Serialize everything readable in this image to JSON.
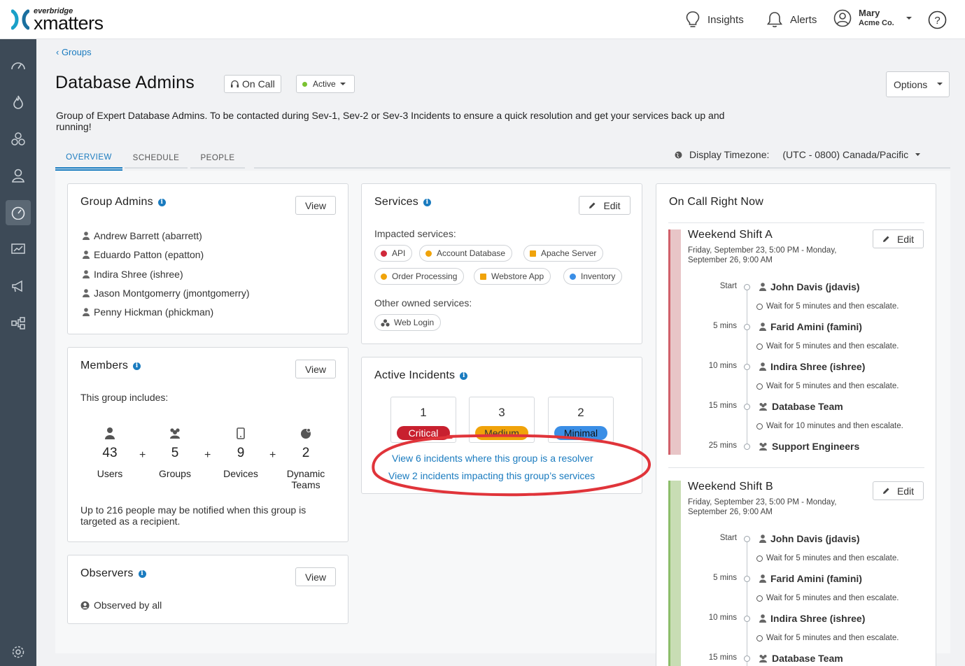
{
  "brand": {
    "small": "everbridge",
    "big": "xmatters"
  },
  "topbar": {
    "insights": "Insights",
    "alerts": "Alerts",
    "user_name": "Mary",
    "user_org": "Acme Co."
  },
  "breadcrumb": "‹ Groups",
  "group": {
    "title": "Database Admins",
    "on_call_label": "On Call",
    "status": "Active",
    "status_color": "#7ac231",
    "description": "Group of Expert Database Admins. To be contacted during Sev-1, Sev-2 or Sev-3 Incidents to ensure a quick resolution and get your services back up and running!"
  },
  "options_label": "Options",
  "tabs": [
    "OVERVIEW",
    "SCHEDULE",
    "PEOPLE"
  ],
  "timezone": {
    "label": "Display Timezone:",
    "value": "(UTC - 0800) Canada/Pacific"
  },
  "admins": {
    "title": "Group Admins",
    "view": "View",
    "people": [
      "Andrew Barrett (abarrett)",
      "Eduardo Patton (epatton)",
      "Indira Shree (ishree)",
      "Jason Montgomerry (jmontgomerry)",
      "Penny Hickman (phickman)"
    ]
  },
  "members": {
    "title": "Members",
    "view": "View",
    "intro": "This group includes:",
    "stats": [
      {
        "num": "43",
        "label": "Users",
        "icon": "user-icon"
      },
      {
        "num": "5",
        "label": "Groups",
        "icon": "group-icon"
      },
      {
        "num": "9",
        "label": "Devices",
        "icon": "device-icon"
      },
      {
        "num": "2",
        "label": "Dynamic Teams",
        "icon": "dynamic-team-icon"
      }
    ],
    "plus": "+",
    "note": "Up to 216 people may be notified when this group is targeted as a recipient."
  },
  "observers": {
    "title": "Observers",
    "view": "View",
    "text": "Observed by all"
  },
  "services": {
    "title": "Services",
    "edit": "Edit",
    "impacted_label": "Impacted services:",
    "impacted": [
      {
        "name": "API",
        "color": "#d0283a"
      },
      {
        "name": "Account Database",
        "color": "#f0a30a"
      },
      {
        "name": "Apache Server",
        "color": "#f0a30a"
      },
      {
        "name": "Order Processing",
        "color": "#f0a30a"
      },
      {
        "name": "Webstore App",
        "color": "#f0a30a"
      },
      {
        "name": "Inventory",
        "color": "#3a8ee6"
      }
    ],
    "owned_label": "Other owned services:",
    "owned": [
      {
        "name": "Web Login"
      }
    ]
  },
  "incidents": {
    "title": "Active Incidents",
    "counts": [
      {
        "num": "1",
        "label": "Critical",
        "color": "#c8202f",
        "text_color": "#ffffff"
      },
      {
        "num": "3",
        "label": "Medium",
        "color": "#f0a30a",
        "text_color": "#333333"
      },
      {
        "num": "2",
        "label": "Minimal",
        "color": "#3a8ee6",
        "text_color": "#111111"
      }
    ],
    "link_resolver": "View 6 incidents where this group is a resolver",
    "link_impacting": "View 2 incidents impacting this group’s services",
    "highlight_color": "#e0343a"
  },
  "oncall": {
    "title": "On Call Right Now",
    "shifts": [
      {
        "name": "Weekend Shift A",
        "edit": "Edit",
        "date": "Friday, September 23, 5:00 PM - Monday, September 26, 9:00 AM",
        "bar_color": "#e8c5c7",
        "bar_edge": "#d0606a",
        "steps": [
          {
            "time": "Start",
            "name": "John Davis (jdavis)",
            "type": "user",
            "wait": "Wait for 5 minutes and then escalate."
          },
          {
            "time": "5 mins",
            "name": "Farid Amini (famini)",
            "type": "user",
            "wait": "Wait for 5 minutes and then escalate."
          },
          {
            "time": "10 mins",
            "name": "Indira Shree (ishree)",
            "type": "user",
            "wait": "Wait for 5 minutes and then escalate."
          },
          {
            "time": "15 mins",
            "name": "Database Team",
            "type": "group",
            "wait": "Wait for 10 minutes and then escalate."
          },
          {
            "time": "25 mins",
            "name": "Support Engineers",
            "type": "group",
            "wait": ""
          }
        ]
      },
      {
        "name": "Weekend Shift B",
        "edit": "Edit",
        "date": "Friday, September 23, 5:00 PM - Monday, September 26, 9:00 AM",
        "bar_color": "#c8ddb4",
        "bar_edge": "#8cbd6a",
        "steps": [
          {
            "time": "Start",
            "name": "John Davis (jdavis)",
            "type": "user",
            "wait": "Wait for 5 minutes and then escalate."
          },
          {
            "time": "5 mins",
            "name": "Farid Amini (famini)",
            "type": "user",
            "wait": "Wait for 5 minutes and then escalate."
          },
          {
            "time": "10 mins",
            "name": "Indira Shree (ishree)",
            "type": "user",
            "wait": "Wait for 5 minutes and then escalate."
          },
          {
            "time": "15 mins",
            "name": "Database Team",
            "type": "group",
            "wait": ""
          }
        ]
      }
    ]
  }
}
